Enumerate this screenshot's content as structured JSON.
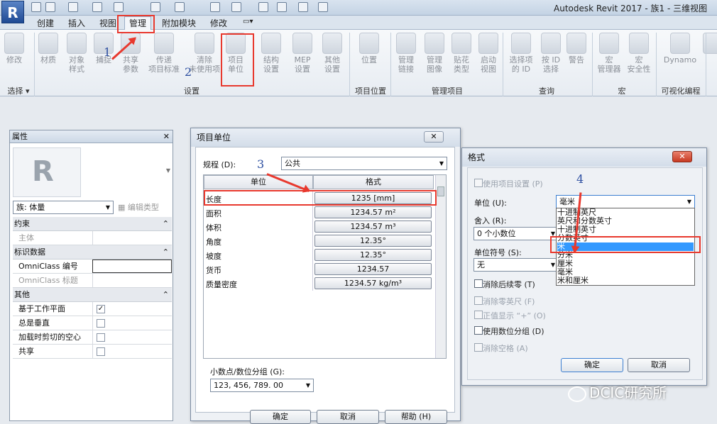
{
  "app": {
    "logo": "R",
    "title": "Autodesk Revit 2017 -    族1 - 三维视图"
  },
  "tabs": [
    "创建",
    "插入",
    "视图",
    "管理",
    "附加模块",
    "修改"
  ],
  "ribbon": {
    "tools": [
      "修改",
      "材质",
      "对象\n样式",
      "捕捉",
      "共享\n参数",
      "传递\n项目标准",
      "清除\n未使用项",
      "项目\n单位",
      "结构\n设置",
      "MEP\n设置",
      "其他\n设置",
      "位置",
      "管理\n链接",
      "管理\n图像",
      "贴花\n类型",
      "启动\n视图",
      "选择项\n的 ID",
      "按 ID\n选择",
      "警告",
      "宏\n管理器",
      "宏\n安全性",
      "Dynamo"
    ],
    "panels": [
      "选择 ▾",
      "设置",
      "项目位置",
      "管理项目",
      "查询",
      "宏",
      "可视化编程"
    ]
  },
  "annotations": [
    "1",
    "2",
    "3",
    "4"
  ],
  "properties": {
    "title": "属性",
    "family": "族: 体量",
    "edit_type": "编辑类型",
    "groups": [
      "约束",
      "标识数据",
      "其他"
    ],
    "rows": [
      "主体",
      "OmniClass 编号",
      "OmniClass 标题",
      "基于工作平面",
      "总是垂直",
      "加载时剪切的空心",
      "共享"
    ],
    "checked": "✓"
  },
  "units_dialog": {
    "title": "项目单位",
    "discipline_label": "规程 (D):",
    "discipline": "公共",
    "col_unit": "单位",
    "col_format": "格式",
    "rows": [
      [
        "长度",
        "1235 [mm]"
      ],
      [
        "面积",
        "1234.57 m²"
      ],
      [
        "体积",
        "1234.57 m³"
      ],
      [
        "角度",
        "12.35°"
      ],
      [
        "坡度",
        "12.35°"
      ],
      [
        "货币",
        "1234.57"
      ],
      [
        "质量密度",
        "1234.57 kg/m³"
      ]
    ],
    "decimal_label": "小数点/数位分组 (G):",
    "decimal": "123, 456, 789. 00",
    "ok": "确定",
    "cancel": "取消",
    "help": "帮助 (H)"
  },
  "format_dialog": {
    "title": "格式",
    "use_project": "使用项目设置 (P)",
    "unit_label": "单位 (U):",
    "unit": "毫米",
    "rounding_label": "舍入 (R):",
    "rounding": "0 个小数位",
    "symbol_label": "单位符号 (S):",
    "symbol": "无",
    "options": [
      "消除后续零 (T)",
      "消除零英尺 (F)",
      "正值显示 “+” (O)",
      "使用数位分组 (D)",
      "消除空格 (A)"
    ],
    "dropdown": [
      "十进制英尺",
      "英尺和分数英寸",
      "十进制英寸",
      "分数英寸",
      "米",
      "分米",
      "厘米",
      "毫米",
      "米和厘米"
    ],
    "ok": "确定",
    "cancel": "取消"
  },
  "watermark": "DCIC研究所"
}
